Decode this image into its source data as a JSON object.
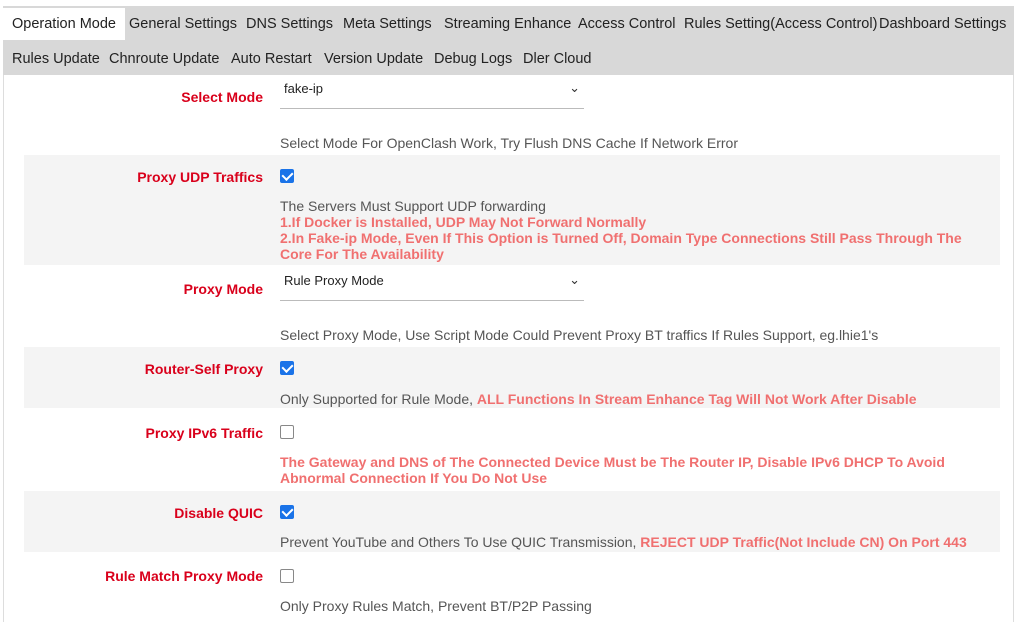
{
  "tabs_row1": [
    {
      "label": "Operation Mode",
      "active": true
    },
    {
      "label": "General Settings"
    },
    {
      "label": "DNS Settings"
    },
    {
      "label": "Meta Settings"
    },
    {
      "label": "Streaming Enhance"
    },
    {
      "label": "Access Control"
    },
    {
      "label": "Rules Setting(Access Control)"
    },
    {
      "label": "Dashboard Settings"
    }
  ],
  "tabs_row2": [
    {
      "label": "Rules Update"
    },
    {
      "label": "Chnroute Update"
    },
    {
      "label": "Auto Restart"
    },
    {
      "label": "Version Update"
    },
    {
      "label": "Debug Logs"
    },
    {
      "label": "Dler Cloud"
    }
  ],
  "settings": {
    "select_mode": {
      "label": "Select Mode",
      "value": "fake-ip",
      "desc": "Select Mode For OpenClash Work, Try Flush DNS Cache If Network Error"
    },
    "proxy_udp": {
      "label": "Proxy UDP Traffics",
      "checked": true,
      "desc": "The Servers Must Support UDP forwarding",
      "warn1": "1.If Docker is Installed, UDP May Not Forward Normally",
      "warn2": "2.In Fake-ip Mode, Even If This Option is Turned Off, Domain Type Connections Still Pass Through The Core For The Availability"
    },
    "proxy_mode": {
      "label": "Proxy Mode",
      "value": "Rule Proxy Mode",
      "desc": "Select Proxy Mode, Use Script Mode Could Prevent Proxy BT traffics If Rules Support, eg.lhie1's"
    },
    "router_self": {
      "label": "Router-Self Proxy",
      "checked": true,
      "desc": "Only Supported for Rule Mode, ",
      "warn": "ALL Functions In Stream Enhance Tag Will Not Work After Disable"
    },
    "ipv6": {
      "label": "Proxy IPv6 Traffic",
      "checked": false,
      "warn": "The Gateway and DNS of The Connected Device Must be The Router IP, Disable IPv6 DHCP To Avoid Abnormal Connection If You Do Not Use"
    },
    "quic": {
      "label": "Disable QUIC",
      "checked": true,
      "desc": "Prevent YouTube and Others To Use QUIC Transmission, ",
      "warn": "REJECT UDP Traffic(Not Include CN) On Port 443"
    },
    "rule_match": {
      "label": "Rule Match Proxy Mode",
      "checked": false,
      "desc": "Only Proxy Rules Match, Prevent BT/P2P Passing"
    }
  },
  "colors": {
    "label_red": "#d9001b",
    "warn": "#f07070",
    "checkbox": "#1a73e8",
    "tabbar": "#d8d8d8"
  }
}
